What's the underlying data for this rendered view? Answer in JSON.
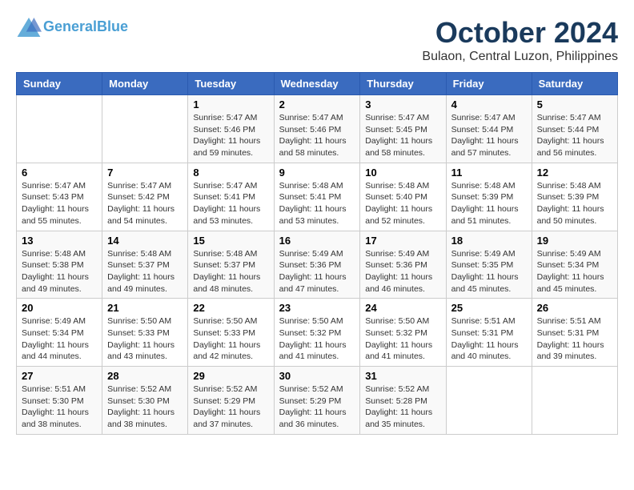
{
  "header": {
    "logo_line1": "General",
    "logo_line2": "Blue",
    "month": "October 2024",
    "location": "Bulaon, Central Luzon, Philippines"
  },
  "columns": [
    "Sunday",
    "Monday",
    "Tuesday",
    "Wednesday",
    "Thursday",
    "Friday",
    "Saturday"
  ],
  "weeks": [
    [
      {
        "day": "",
        "sunrise": "",
        "sunset": "",
        "daylight": ""
      },
      {
        "day": "",
        "sunrise": "",
        "sunset": "",
        "daylight": ""
      },
      {
        "day": "1",
        "sunrise": "Sunrise: 5:47 AM",
        "sunset": "Sunset: 5:46 PM",
        "daylight": "Daylight: 11 hours and 59 minutes."
      },
      {
        "day": "2",
        "sunrise": "Sunrise: 5:47 AM",
        "sunset": "Sunset: 5:46 PM",
        "daylight": "Daylight: 11 hours and 58 minutes."
      },
      {
        "day": "3",
        "sunrise": "Sunrise: 5:47 AM",
        "sunset": "Sunset: 5:45 PM",
        "daylight": "Daylight: 11 hours and 58 minutes."
      },
      {
        "day": "4",
        "sunrise": "Sunrise: 5:47 AM",
        "sunset": "Sunset: 5:44 PM",
        "daylight": "Daylight: 11 hours and 57 minutes."
      },
      {
        "day": "5",
        "sunrise": "Sunrise: 5:47 AM",
        "sunset": "Sunset: 5:44 PM",
        "daylight": "Daylight: 11 hours and 56 minutes."
      }
    ],
    [
      {
        "day": "6",
        "sunrise": "Sunrise: 5:47 AM",
        "sunset": "Sunset: 5:43 PM",
        "daylight": "Daylight: 11 hours and 55 minutes."
      },
      {
        "day": "7",
        "sunrise": "Sunrise: 5:47 AM",
        "sunset": "Sunset: 5:42 PM",
        "daylight": "Daylight: 11 hours and 54 minutes."
      },
      {
        "day": "8",
        "sunrise": "Sunrise: 5:47 AM",
        "sunset": "Sunset: 5:41 PM",
        "daylight": "Daylight: 11 hours and 53 minutes."
      },
      {
        "day": "9",
        "sunrise": "Sunrise: 5:48 AM",
        "sunset": "Sunset: 5:41 PM",
        "daylight": "Daylight: 11 hours and 53 minutes."
      },
      {
        "day": "10",
        "sunrise": "Sunrise: 5:48 AM",
        "sunset": "Sunset: 5:40 PM",
        "daylight": "Daylight: 11 hours and 52 minutes."
      },
      {
        "day": "11",
        "sunrise": "Sunrise: 5:48 AM",
        "sunset": "Sunset: 5:39 PM",
        "daylight": "Daylight: 11 hours and 51 minutes."
      },
      {
        "day": "12",
        "sunrise": "Sunrise: 5:48 AM",
        "sunset": "Sunset: 5:39 PM",
        "daylight": "Daylight: 11 hours and 50 minutes."
      }
    ],
    [
      {
        "day": "13",
        "sunrise": "Sunrise: 5:48 AM",
        "sunset": "Sunset: 5:38 PM",
        "daylight": "Daylight: 11 hours and 49 minutes."
      },
      {
        "day": "14",
        "sunrise": "Sunrise: 5:48 AM",
        "sunset": "Sunset: 5:37 PM",
        "daylight": "Daylight: 11 hours and 49 minutes."
      },
      {
        "day": "15",
        "sunrise": "Sunrise: 5:48 AM",
        "sunset": "Sunset: 5:37 PM",
        "daylight": "Daylight: 11 hours and 48 minutes."
      },
      {
        "day": "16",
        "sunrise": "Sunrise: 5:49 AM",
        "sunset": "Sunset: 5:36 PM",
        "daylight": "Daylight: 11 hours and 47 minutes."
      },
      {
        "day": "17",
        "sunrise": "Sunrise: 5:49 AM",
        "sunset": "Sunset: 5:36 PM",
        "daylight": "Daylight: 11 hours and 46 minutes."
      },
      {
        "day": "18",
        "sunrise": "Sunrise: 5:49 AM",
        "sunset": "Sunset: 5:35 PM",
        "daylight": "Daylight: 11 hours and 45 minutes."
      },
      {
        "day": "19",
        "sunrise": "Sunrise: 5:49 AM",
        "sunset": "Sunset: 5:34 PM",
        "daylight": "Daylight: 11 hours and 45 minutes."
      }
    ],
    [
      {
        "day": "20",
        "sunrise": "Sunrise: 5:49 AM",
        "sunset": "Sunset: 5:34 PM",
        "daylight": "Daylight: 11 hours and 44 minutes."
      },
      {
        "day": "21",
        "sunrise": "Sunrise: 5:50 AM",
        "sunset": "Sunset: 5:33 PM",
        "daylight": "Daylight: 11 hours and 43 minutes."
      },
      {
        "day": "22",
        "sunrise": "Sunrise: 5:50 AM",
        "sunset": "Sunset: 5:33 PM",
        "daylight": "Daylight: 11 hours and 42 minutes."
      },
      {
        "day": "23",
        "sunrise": "Sunrise: 5:50 AM",
        "sunset": "Sunset: 5:32 PM",
        "daylight": "Daylight: 11 hours and 41 minutes."
      },
      {
        "day": "24",
        "sunrise": "Sunrise: 5:50 AM",
        "sunset": "Sunset: 5:32 PM",
        "daylight": "Daylight: 11 hours and 41 minutes."
      },
      {
        "day": "25",
        "sunrise": "Sunrise: 5:51 AM",
        "sunset": "Sunset: 5:31 PM",
        "daylight": "Daylight: 11 hours and 40 minutes."
      },
      {
        "day": "26",
        "sunrise": "Sunrise: 5:51 AM",
        "sunset": "Sunset: 5:31 PM",
        "daylight": "Daylight: 11 hours and 39 minutes."
      }
    ],
    [
      {
        "day": "27",
        "sunrise": "Sunrise: 5:51 AM",
        "sunset": "Sunset: 5:30 PM",
        "daylight": "Daylight: 11 hours and 38 minutes."
      },
      {
        "day": "28",
        "sunrise": "Sunrise: 5:52 AM",
        "sunset": "Sunset: 5:30 PM",
        "daylight": "Daylight: 11 hours and 38 minutes."
      },
      {
        "day": "29",
        "sunrise": "Sunrise: 5:52 AM",
        "sunset": "Sunset: 5:29 PM",
        "daylight": "Daylight: 11 hours and 37 minutes."
      },
      {
        "day": "30",
        "sunrise": "Sunrise: 5:52 AM",
        "sunset": "Sunset: 5:29 PM",
        "daylight": "Daylight: 11 hours and 36 minutes."
      },
      {
        "day": "31",
        "sunrise": "Sunrise: 5:52 AM",
        "sunset": "Sunset: 5:28 PM",
        "daylight": "Daylight: 11 hours and 35 minutes."
      },
      {
        "day": "",
        "sunrise": "",
        "sunset": "",
        "daylight": ""
      },
      {
        "day": "",
        "sunrise": "",
        "sunset": "",
        "daylight": ""
      }
    ]
  ]
}
